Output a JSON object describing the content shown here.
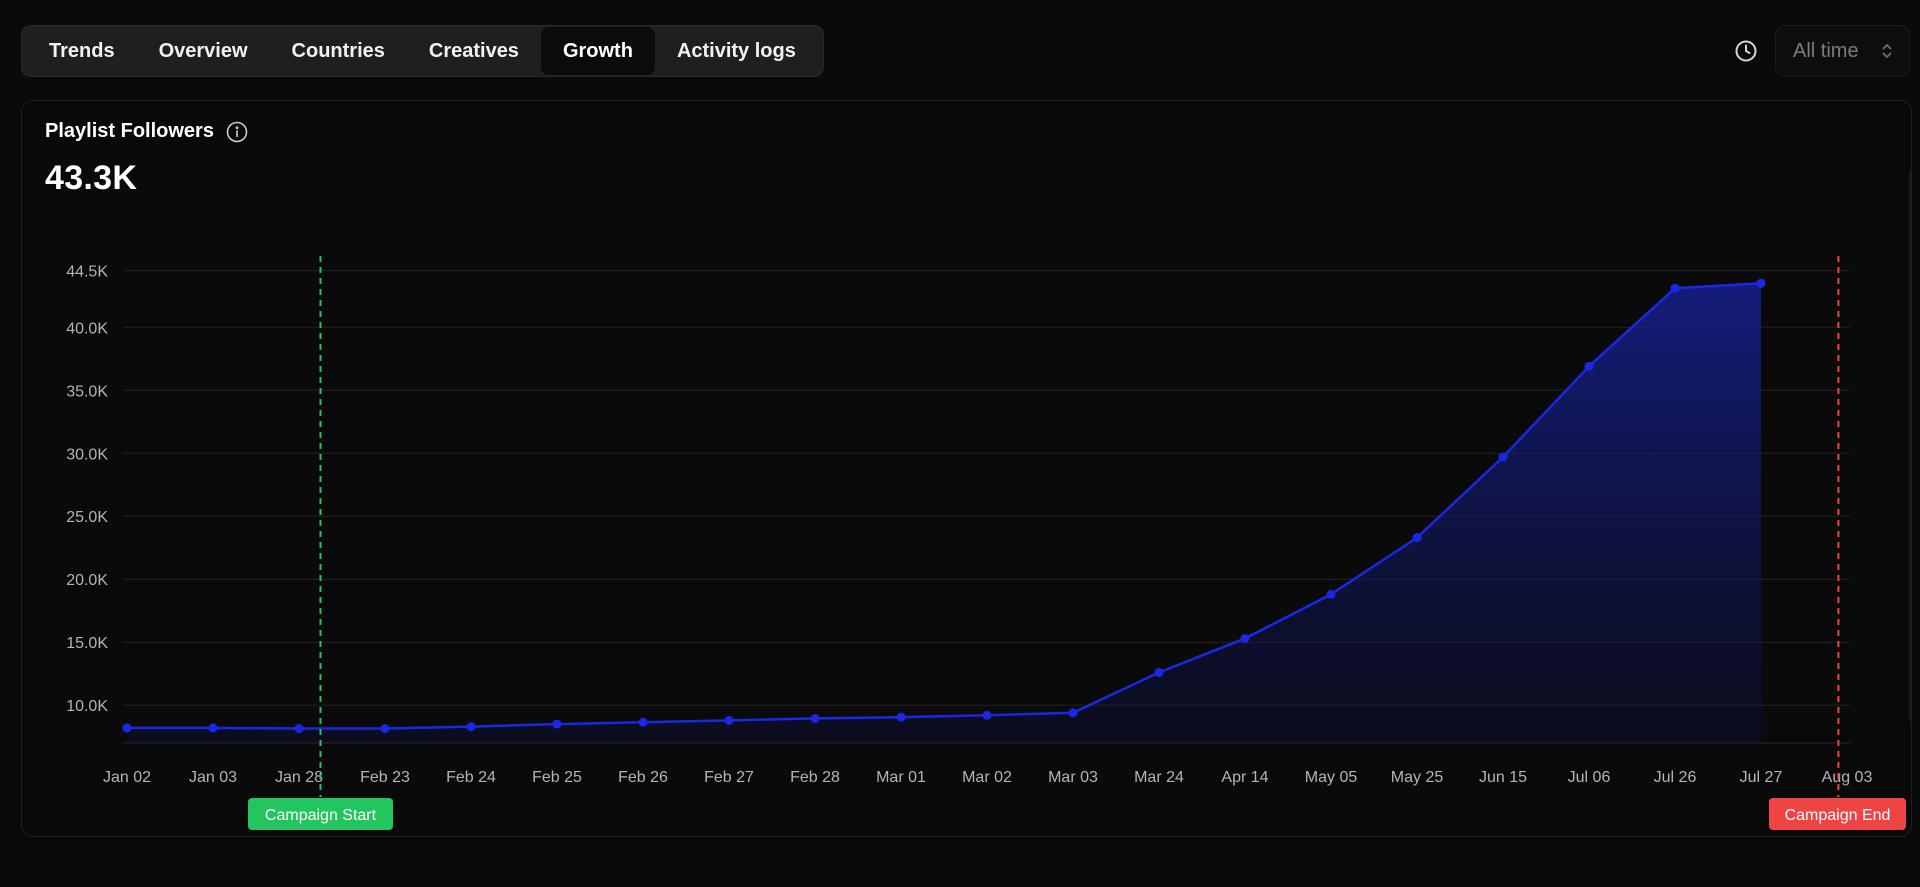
{
  "tabs": [
    {
      "label": "Trends",
      "active": false
    },
    {
      "label": "Overview",
      "active": false
    },
    {
      "label": "Countries",
      "active": false
    },
    {
      "label": "Creatives",
      "active": false
    },
    {
      "label": "Growth",
      "active": true
    },
    {
      "label": "Activity logs",
      "active": false
    }
  ],
  "controls": {
    "time_range": "All time",
    "clock_icon": "clock-icon",
    "select_icon": "chevron-up-down-icon"
  },
  "card": {
    "title": "Playlist Followers",
    "info_icon": "info-icon",
    "value": "43.3K"
  },
  "colors": {
    "line": "#1a28e6",
    "area_top": "#16208f",
    "campaign_start": "#22c55e",
    "campaign_end": "#ef4444",
    "grid": "#222222"
  },
  "chart_data": {
    "type": "area",
    "x": [
      "Jan 02",
      "Jan 03",
      "Jan 28",
      "Feb 23",
      "Feb 24",
      "Feb 25",
      "Feb 26",
      "Feb 27",
      "Feb 28",
      "Mar 01",
      "Mar 02",
      "Mar 03",
      "Mar 24",
      "Apr 14",
      "May 05",
      "May 25",
      "Jun 15",
      "Jul 06",
      "Jul 26",
      "Jul 27",
      "Aug 03"
    ],
    "series": [
      {
        "values": [
          8200,
          8200,
          8150,
          8150,
          8300,
          8500,
          8650,
          8800,
          8950,
          9050,
          9200,
          9400,
          12600,
          15300,
          18800,
          23300,
          29700,
          36900,
          43100,
          43500,
          null
        ]
      }
    ],
    "y_ticks": [
      10000,
      15000,
      20000,
      25000,
      30000,
      35000,
      40000,
      44500
    ],
    "y_tick_labels": [
      "10.0K",
      "15.0K",
      "20.0K",
      "25.0K",
      "30.0K",
      "35.0K",
      "40.0K",
      "44.5K"
    ],
    "ylim": [
      7000,
      45500
    ],
    "grid": true,
    "annotations": [
      {
        "label": "Campaign Start",
        "x": "Jan 28",
        "offset": 0.25,
        "color": "#22c55e"
      },
      {
        "label": "Campaign End",
        "x": "Aug 03",
        "offset": -0.1,
        "color": "#ef4444"
      }
    ]
  }
}
